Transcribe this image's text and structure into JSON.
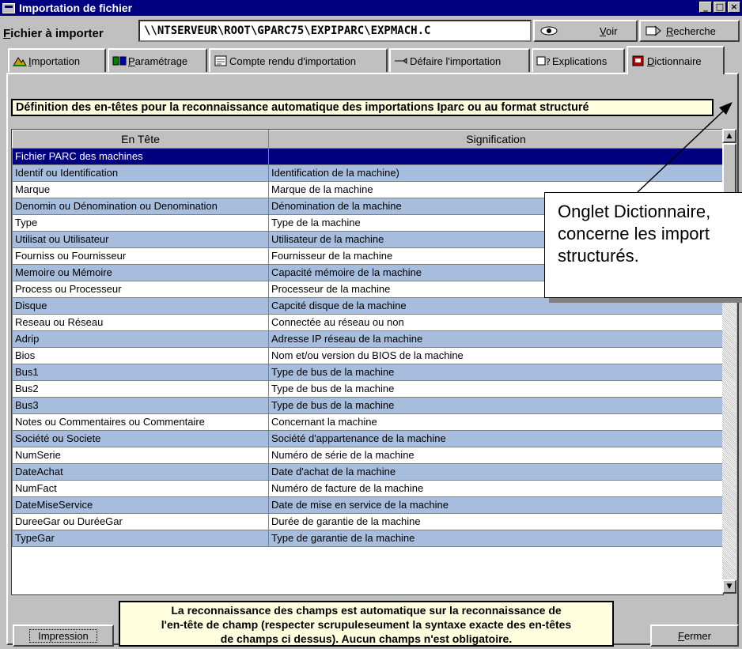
{
  "window": {
    "title": "Importation de fichier",
    "buttons": {
      "minimize": "_",
      "maximize": "□",
      "close": "×"
    }
  },
  "file": {
    "label": "Fichier à importer",
    "path": "\\\\NTSERVEUR\\ROOT\\GPARC75\\EXPIPARC\\EXPMACH.C",
    "voir_label": "Voir",
    "recherche_label": "Recherche"
  },
  "tabs": [
    {
      "label": "Importation",
      "icon": "mountain-icon"
    },
    {
      "label": "Paramétrage",
      "icon": "settings-icon"
    },
    {
      "label": "Compte rendu d'importation",
      "icon": "report-icon"
    },
    {
      "label": "Défaire l'importation",
      "icon": "undo-icon"
    },
    {
      "label": "Explications",
      "icon": "help-icon"
    },
    {
      "label": "Dictionnaire",
      "icon": "dictionary-icon"
    }
  ],
  "active_tab": "Dictionnaire",
  "definition_header": "Définition des en-têtes pour la reconnaissance automatique des importations Iparc ou au format structuré",
  "grid": {
    "columns": [
      "En Tête",
      "Signification"
    ],
    "rows": [
      [
        "Fichier PARC des machines",
        ""
      ],
      [
        "Identif ou Identification",
        "Identification de la machine)"
      ],
      [
        "Marque",
        "Marque de la machine"
      ],
      [
        "Denomin ou Dénomination ou Denomination",
        "Dénomination de la machine"
      ],
      [
        "Type",
        "Type  de la machine"
      ],
      [
        "Utilisat ou Utilisateur",
        "Utilisateur de la machine"
      ],
      [
        "Fourniss ou Fournisseur",
        "Fournisseur de la machine"
      ],
      [
        "Memoire ou Mémoire",
        "Capacité mémoire de la machine"
      ],
      [
        "Process ou Processeur",
        "Processeur de la machine"
      ],
      [
        "Disque",
        "Capcité disque  de la machine"
      ],
      [
        "Reseau ou Réseau",
        "Connectée au réseau ou non"
      ],
      [
        "Adrip",
        "Adresse IP réseau de la machine"
      ],
      [
        "Bios",
        "Nom et/ou version du BIOS de la machine"
      ],
      [
        "Bus1",
        "Type de bus de la machine"
      ],
      [
        "Bus2",
        "Type de bus de la machine"
      ],
      [
        "Bus3",
        "Type de bus de la machine"
      ],
      [
        "Notes ou Commentaires ou Commentaire",
        "Concernant la machine"
      ],
      [
        "Société ou Societe",
        "Société d'appartenance de la machine"
      ],
      [
        "NumSerie",
        "Numéro de série de la machine"
      ],
      [
        "DateAchat",
        "Date d'achat de la machine"
      ],
      [
        "NumFact",
        "Numéro de facture de la machine"
      ],
      [
        "DateMiseService",
        "Date de mise en service de la machine"
      ],
      [
        "DureeGar ou DuréeGar",
        "Durée de garantie de la machine"
      ],
      [
        "TypeGar",
        "Type de garantie de la machine"
      ]
    ],
    "scroll_up": "▲",
    "scroll_down": "▼"
  },
  "callout": {
    "line1": "Onglet Dictionnaire,",
    "line2": "concerne les import",
    "line3": "structurés."
  },
  "footer": {
    "impression_label": "Impression",
    "info_text": "La reconnaissance des champs est automatique sur la reconnaissance de\nl'en-tête de champ (respecter scrupuleseument la syntaxe exacte des en-têtes\nde champs ci dessus). Aucun champs n'est obligatoire.",
    "fermer_label": "Fermer"
  },
  "colors": {
    "titlebar": "#000080",
    "row_alt": "#a7bddd",
    "selected_row": "#000080",
    "info_bg": "#ffffe0"
  }
}
